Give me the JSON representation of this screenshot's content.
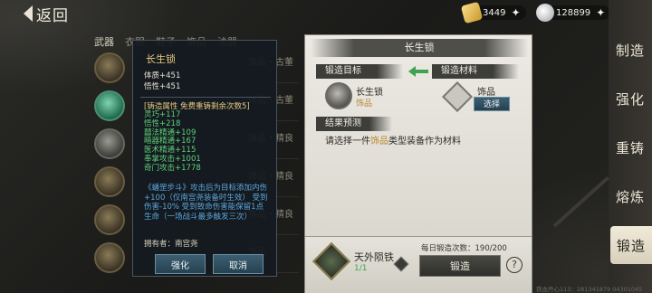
{
  "top_bar": {
    "back_label": "返回",
    "gold": "3449",
    "silver": "128899",
    "plus_symbol": "✦"
  },
  "right_nav": {
    "items": [
      {
        "label": "制造",
        "icon": "craft-icon"
      },
      {
        "label": "强化",
        "icon": "enhance-icon"
      },
      {
        "label": "重铸",
        "icon": "recast-icon"
      },
      {
        "label": "熔炼",
        "icon": "smelt-icon"
      },
      {
        "label": "锻造",
        "icon": "forge-icon",
        "active": true
      }
    ]
  },
  "category_tabs": [
    "武器",
    "衣服",
    "鞋子",
    "饰品",
    "法器"
  ],
  "ghost_rows": [
    "饰品・古董",
    "饰品・古董",
    "饰品・精良",
    "饰品・精良",
    "饰品・精良",
    "饰品"
  ],
  "tooltip": {
    "title": "长生锁",
    "stats": [
      "体质+451",
      "悟性+451"
    ],
    "forge_header": "[铸造属性  免费重铸剩余次数5]",
    "forge_attrs": [
      "灵巧+117",
      "悟性+218",
      "囍法精通+109",
      "暗器精通+167",
      "医术精通+115",
      "奉掌攻击+1001",
      "奇门攻击+1778"
    ],
    "skill_text": "《蟠罡步斗》攻击后为目标添加内伤+100（仅南宫尧装备时生效） 受到伤害-10% 受到致命伤害能保留1点生命（一场战斗最多触发三次）",
    "owner": "拥有者：南宫尧",
    "enhance_label": "强化",
    "cancel_label": "取消"
  },
  "forge_panel": {
    "title": "长生锁",
    "target_label": "锻造目标",
    "material_label": "锻造材料",
    "target_name": "长生锁",
    "target_type": "饰品",
    "material_name": "饰品",
    "select_label": "选择",
    "preview_label": "结果预测",
    "preview_prefix": "请选择一件",
    "preview_highlight": "饰品",
    "preview_suffix": "类型装备作为材料",
    "iron_name": "天外陨铁",
    "iron_count": "1/1",
    "daily_count": "每日锻造次数：190/200",
    "forge_label": "锻造",
    "help_symbol": "?"
  },
  "watermark": "铁血丹心113：281341879 04301045",
  "colors": {
    "accent_gold": "#e8c982",
    "attr_green": "#5fd07a",
    "skill_blue": "#5aa6e0",
    "button_blue": "#3d5f73"
  }
}
